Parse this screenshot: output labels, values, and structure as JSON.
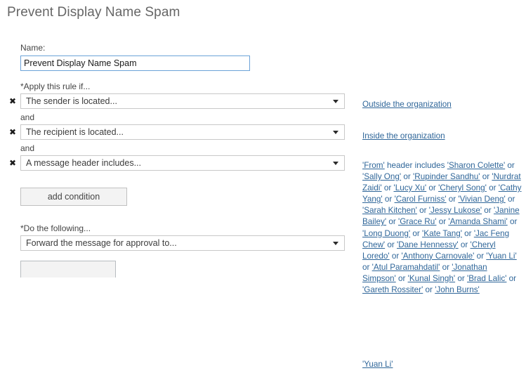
{
  "page": {
    "title": "Prevent Display Name Spam"
  },
  "name_field": {
    "label": "Name:",
    "value": "Prevent Display Name Spam",
    "placeholder": ""
  },
  "conditions_section": {
    "label": "*Apply this rule if...",
    "separator": "and",
    "remove_icon": "remove-icon",
    "add_button_label": "add condition",
    "rows": [
      {
        "select_value": "The sender is located...",
        "value_link": "Outside the organization"
      },
      {
        "select_value": "The recipient is located...",
        "value_link": "Inside the organization"
      },
      {
        "select_value": "A message header includes...",
        "value_link": "'From' header includes 'Sharon Colette' or 'Sally Ong' or 'Rupinder Sandhu' or 'Nurdrat Zaidi' or 'Lucy Xu' or 'Cheryl Song' or 'Cathy Yang' or 'Carol Furniss' or 'Vivian Deng' or 'Sarah Kitchen' or 'Jessy Lukose' or 'Janine Bailey' or 'Grace Ru' or 'Amanda Shami' or 'Long Duong' or 'Kate Tang' or 'Jac Feng Chew' or 'Dane Hennessy' or 'Cheryl Loredo' or 'Anthony Carnovale' or 'Yuan Li' or 'Atul Paramahdatil' or 'Jonathan Simpson' or 'Kunal Singh' or 'Brad Lalic' or 'Gareth Rossiter' or 'John Burns'",
        "header_name": "'From'",
        "header_mid": " header includes ",
        "names": [
          "'Sharon Colette'",
          "'Sally Ong'",
          "'Rupinder Sandhu'",
          "'Nurdrat Zaidi'",
          "'Lucy Xu'",
          "'Cheryl Song'",
          "'Cathy Yang'",
          "'Carol Furniss'",
          "'Vivian Deng'",
          "'Sarah Kitchen'",
          "'Jessy Lukose'",
          "'Janine Bailey'",
          "'Grace Ru'",
          "'Amanda Shami'",
          "'Long Duong'",
          "'Kate Tang'",
          "'Jac Feng Chew'",
          "'Dane Hennessy'",
          "'Cheryl Loredo'",
          "'Anthony Carnovale'",
          "'Yuan Li'",
          "'Atul Paramahdatil'",
          "'Jonathan Simpson'",
          "'Kunal Singh'",
          "'Brad Lalic'",
          "'Gareth Rossiter'",
          "'John Burns'"
        ],
        "joiner": " or "
      }
    ]
  },
  "actions_section": {
    "label": "*Do the following...",
    "rows": [
      {
        "select_value": "Forward the message for approval to...",
        "value_link": "'Yuan Li'"
      }
    ]
  }
}
